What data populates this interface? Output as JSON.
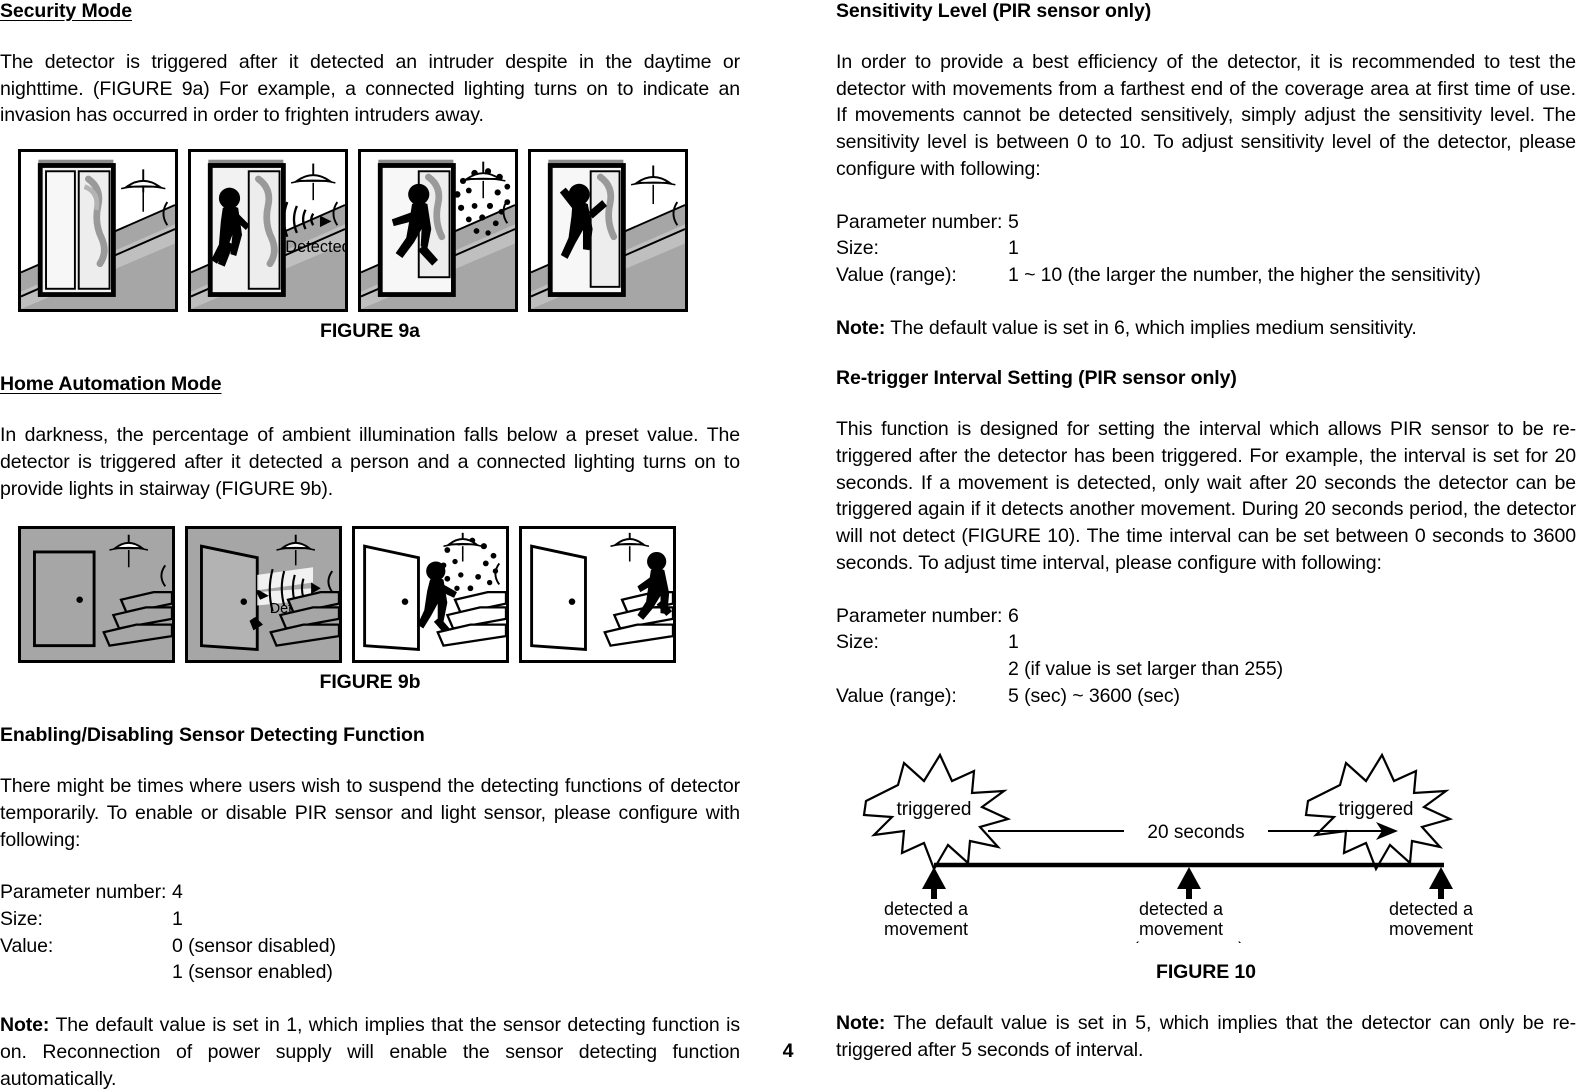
{
  "document": {
    "page_number": "4"
  },
  "left_column": {
    "security_mode": {
      "heading": "Security Mode",
      "paragraph": "The detector is triggered after it detected an intruder despite in the daytime or nighttime. (FIGURE 9a)    For example, a connected lighting turns on to indicate an invasion has occurred in order to frighten intruders away."
    },
    "figure_9a": {
      "caption": "FIGURE 9a",
      "panels": [
        {
          "name": "closed-sliding-door-night",
          "detected_label": "",
          "lit": false,
          "person": false
        },
        {
          "name": "intruder-entering-detected",
          "detected_label": "Detected",
          "lit": false,
          "person": true
        },
        {
          "name": "light-turns-on-intruder-flees",
          "detected_label": "",
          "lit": true,
          "person": true
        },
        {
          "name": "intruder-escaping",
          "detected_label": "",
          "lit": false,
          "person": true
        }
      ]
    },
    "home_automation_mode": {
      "heading": "Home Automation Mode",
      "paragraph": "In darkness, the percentage of ambient illumination falls below a preset value. The detector is triggered after it detected a person and a connected lighting turns on to provide lights in stairway (FIGURE 9b)."
    },
    "figure_9b": {
      "caption": "FIGURE 9b",
      "panels": [
        {
          "name": "dark-stairway-closed-door",
          "detected_label": "",
          "dark": true,
          "person": false
        },
        {
          "name": "door-opens-detected",
          "detected_label": "Detected",
          "dark": true,
          "person": false
        },
        {
          "name": "light-on-person-walks",
          "detected_label": "",
          "dark": false,
          "person": true
        },
        {
          "name": "person-climbs-stairs",
          "detected_label": "",
          "dark": false,
          "person": true
        }
      ]
    },
    "enabling_disabling": {
      "heading": "Enabling/Disabling Sensor Detecting Function",
      "paragraph": "There might be times where users wish to suspend the detecting functions of detector temporarily.    To enable or disable PIR sensor and light sensor, please configure with following:",
      "parameters": [
        {
          "label": "Parameter number:",
          "value": "4"
        },
        {
          "label": "Size:",
          "value": "1"
        },
        {
          "label": "Value:",
          "value": "0 (sensor disabled)"
        },
        {
          "label": "",
          "value": "1 (sensor enabled)"
        }
      ],
      "note_label": "Note:",
      "note_text": " The default value is set in 1, which implies that the sensor detecting function is on.    Reconnection of power supply will enable the sensor detecting function automatically."
    }
  },
  "right_column": {
    "sensitivity_level": {
      "heading": "Sensitivity Level (PIR sensor only)",
      "paragraph": "In order to provide a best efficiency of the detector, it is recommended to test the detector with movements from a farthest end of the coverage area at first time of use.    If movements cannot be detected sensitively, simply adjust the sensitivity level. The sensitivity level is between 0 to 10.    To adjust sensitivity level of the detector, please configure with following:",
      "parameters": [
        {
          "label": "Parameter number:",
          "value": "5"
        },
        {
          "label": "Size:",
          "value": "1"
        },
        {
          "label": "Value (range):",
          "value": "1 ~ 10 (the larger the number, the higher the sensitivity)"
        }
      ],
      "note_label": "Note:",
      "note_text": " The default value is set in 6, which implies medium sensitivity."
    },
    "retrigger_interval": {
      "heading": "Re-trigger Interval Setting (PIR sensor only)",
      "paragraph": "This function is designed for setting the interval which allows PIR sensor to be re-triggered after the detector has been triggered.    For example, the interval is set for 20 seconds.    If a movement is detected, only wait after 20 seconds the detector can be triggered again if it detects another movement.   During 20 seconds period, the detector will not detect (FIGURE 10).    The time interval can be set between 0 seconds to 3600 seconds.   To adjust time interval, please configure with following:",
      "parameters": [
        {
          "label": "Parameter number:",
          "value": "6"
        },
        {
          "label": "Size:",
          "value": "1"
        },
        {
          "label": "",
          "value": "2 (if value is set larger than 255)"
        },
        {
          "label": "Value (range):",
          "value": "5 (sec) ~ 3600 (sec)"
        }
      ],
      "note_label": "Note:",
      "note_text": " The default value is set in 5, which implies that the detector can only be re-triggered after 5 seconds of interval."
    },
    "figure_10": {
      "caption": "FIGURE 10",
      "burst_left_label": "triggered",
      "burst_right_label": "triggered",
      "interval_label": "20 seconds",
      "marker_left_line1": "detected a",
      "marker_left_line2": "movement",
      "marker_middle_line1": "detected a",
      "marker_middle_line2": "movement",
      "marker_middle_line3": "(no response)",
      "marker_right_line1": "detected a",
      "marker_right_line2": "movement"
    }
  },
  "colors": {
    "ink": "#000000",
    "paper": "#ffffff",
    "panel_gray": "#a6a6a6",
    "panel_light_gray": "#d9d9d9",
    "glass": "#f2f2f2"
  }
}
